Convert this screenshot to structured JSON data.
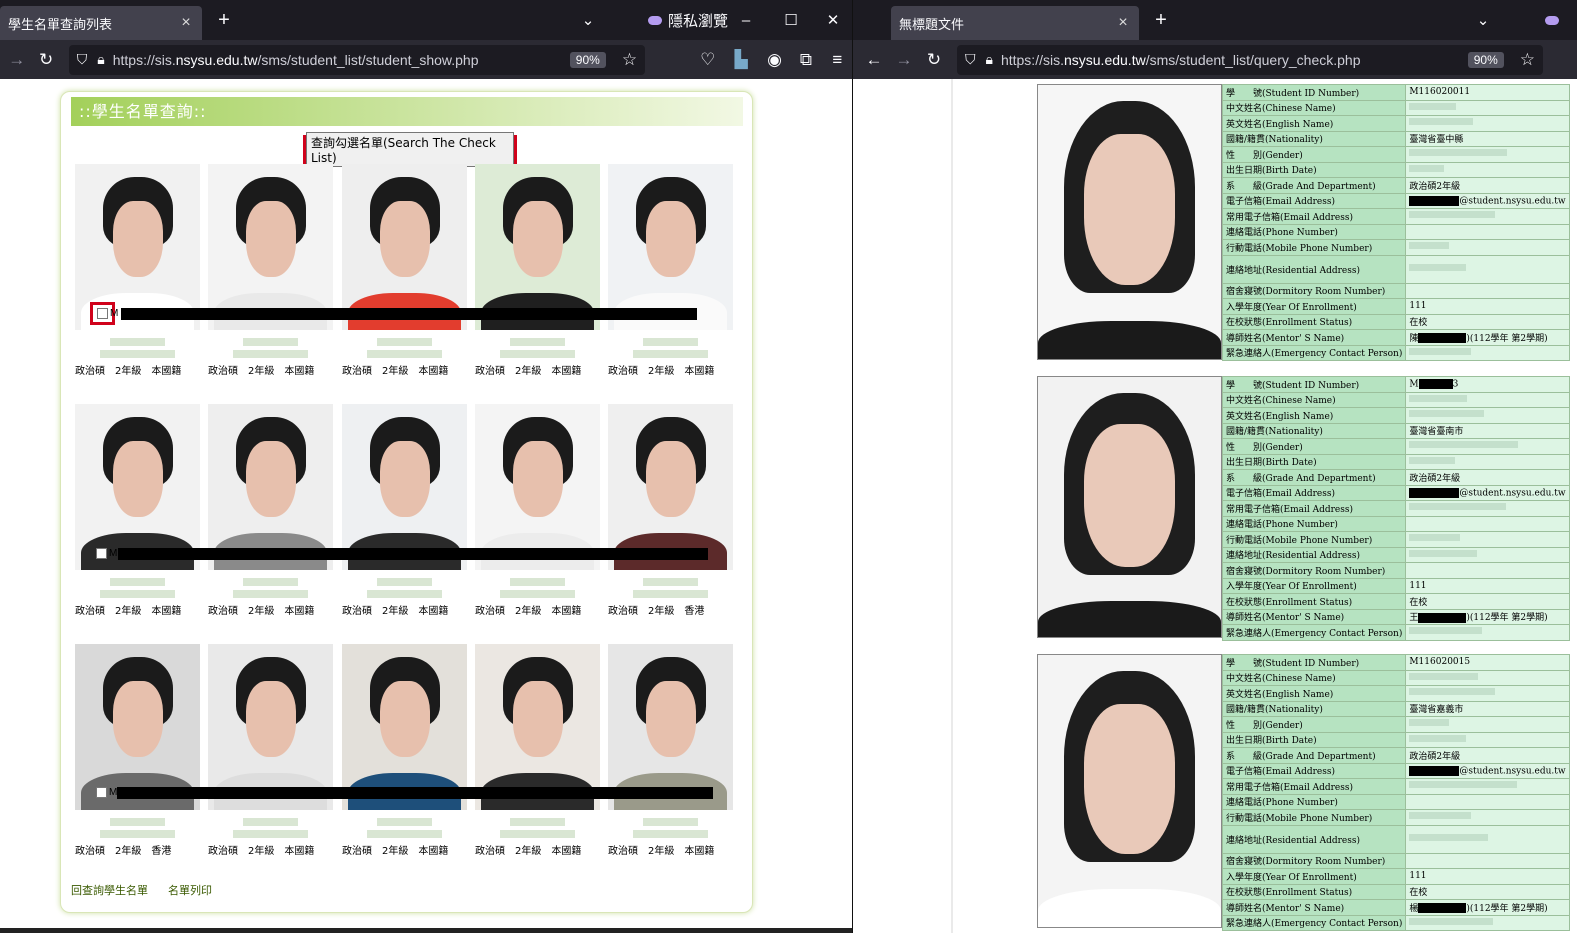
{
  "left_window": {
    "tab_title": "學生名單查詢列表",
    "private_label": "隱私瀏覽",
    "url_prefix": "https://sis.",
    "url_domain": "nsysu.edu.tw",
    "url_path": "/sms/student_list/student_show.php",
    "zoom": "90%",
    "page": {
      "title": "::學生名單查詢::",
      "search_button": "查詢勾選名單(Search The Check List)",
      "students": [
        {
          "dept": "政治碩",
          "grade": "2年級",
          "nationality": "本國籍"
        },
        {
          "dept": "政治碩",
          "grade": "2年級",
          "nationality": "本國籍"
        },
        {
          "dept": "政治碩",
          "grade": "2年級",
          "nationality": "本國籍"
        },
        {
          "dept": "政治碩",
          "grade": "2年級",
          "nationality": "本國籍"
        },
        {
          "dept": "政治碩",
          "grade": "2年級",
          "nationality": "本國籍"
        },
        {
          "dept": "政治碩",
          "grade": "2年級",
          "nationality": "本國籍"
        },
        {
          "dept": "政治碩",
          "grade": "2年級",
          "nationality": "本國籍"
        },
        {
          "dept": "政治碩",
          "grade": "2年級",
          "nationality": "本國籍"
        },
        {
          "dept": "政治碩",
          "grade": "2年級",
          "nationality": "本國籍"
        },
        {
          "dept": "政治碩",
          "grade": "2年級",
          "nationality": "香港"
        },
        {
          "dept": "政治碩",
          "grade": "2年級",
          "nationality": "香港"
        },
        {
          "dept": "政治碩",
          "grade": "2年級",
          "nationality": "本國籍"
        },
        {
          "dept": "政治碩",
          "grade": "2年級",
          "nationality": "本國籍"
        },
        {
          "dept": "政治碩",
          "grade": "2年級",
          "nationality": "本國籍"
        },
        {
          "dept": "政治碩",
          "grade": "2年級",
          "nationality": "本國籍"
        }
      ],
      "id_prefix": "M",
      "link_back": "回查詢學生名單",
      "link_print": "名單列印"
    }
  },
  "right_window": {
    "tab_title": "無標題文件",
    "url_prefix": "https://sis.",
    "url_domain": "nsysu.edu.tw",
    "url_path": "/sms/student_list/query_check.php",
    "zoom": "90%",
    "field_labels": [
      "學　　號(Student ID Number)",
      "中文姓名(Chinese Name)",
      "英文姓名(English Name)",
      "國籍/籍貫(Nationality)",
      "性　　別(Gender)",
      "出生日期(Birth Date)",
      "系　　級(Grade And Department)",
      "電子信箱(Email Address)",
      "常用電子信箱(Email Address)",
      "連絡電話(Phone Number)",
      "行動電話(Mobile Phone Number)",
      "連絡地址(Residential Address)",
      "宿舍寢號(Dormitory Room Number)",
      "入學年度(Year Of Enrollment)",
      "在校狀態(Enrollment Status)",
      "導師姓名(Mentor' S Name)",
      "緊急連絡人(Emergency Contact Person)"
    ],
    "records": [
      {
        "id": "M116020011",
        "nationality": "臺灣省臺中縣",
        "grade_dept": "政治碩2年級",
        "email_suffix": "@student.nsysu.edu.tw",
        "year": "111",
        "status": "在校",
        "mentor_prefix": "陳",
        "mentor_term": ")(112學年 第2學期)"
      },
      {
        "id_prefix": "M",
        "id_suffix": "3",
        "nationality": "臺灣省臺南市",
        "grade_dept": "政治碩2年級",
        "email_suffix": "@student.nsysu.edu.tw",
        "year": "111",
        "status": "在校",
        "mentor_prefix": "王",
        "mentor_term": ")(112學年 第2學期)"
      },
      {
        "id": "M116020015",
        "nationality": "臺灣省嘉義市",
        "grade_dept": "政治碩2年級",
        "email_suffix": "@student.nsysu.edu.tw",
        "year": "111",
        "status": "在校",
        "mentor_prefix": "楊",
        "mentor_term": ")(112學年 第2學期)"
      }
    ]
  },
  "colors": {
    "title_green": "#a3d05a",
    "key_cell": "#b6e3c1",
    "val_cell": "#ddf5e4",
    "highlight_red": "#d0021b"
  }
}
